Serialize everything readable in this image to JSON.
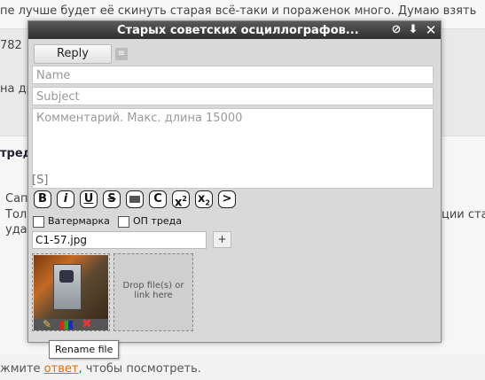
{
  "background": {
    "line1": "пе лучше будет её скинуть старая всё-таки и пораженок много. Думаю взять",
    "post_number": "782",
    "fragment_nadr": "на др",
    "thread_link": "тред",
    "fragment_sap": "Сап",
    "fragment_tol": "Тол",
    "fragment_uda": "уда",
    "fragment_right": "ции ста",
    "footer_prefix": "жмите ",
    "footer_link": "ответ",
    "footer_suffix": ", чтобы посмотреть."
  },
  "popup": {
    "title": "Старых советских осциллографов...",
    "reply_label": "Reply",
    "name_placeholder": "Name",
    "subject_placeholder": "Subject",
    "comment_placeholder": "Комментарий. Макс. длина 15000",
    "spoiler_tag": "[S]",
    "markup": [
      "B",
      "i",
      "U",
      "S",
      "C",
      ">"
    ],
    "watermark_label": "Ватермарка",
    "op_label": "ОП треда",
    "file_name": "C1-57.jpg",
    "add_label": "+",
    "drop_text": "Drop file(s) or link here",
    "tooltip": "Rename file"
  },
  "colors": {
    "titlebar": "#3b3b3b",
    "link": "#e36d00",
    "remove": "#e33333"
  }
}
